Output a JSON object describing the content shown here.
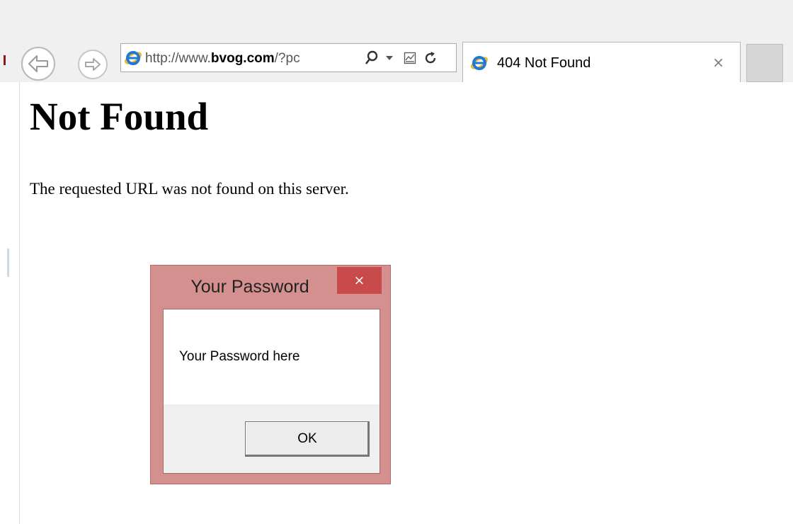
{
  "browser": {
    "address": {
      "url_prefix": "http://www.",
      "url_domain": "bvog.com",
      "url_suffix": "/?pc"
    },
    "tab": {
      "title": "404 Not Found",
      "close_glyph": "×"
    },
    "icons": {
      "back": "back-arrow-icon",
      "forward": "forward-arrow-icon",
      "ie_logo": "internet-explorer-icon",
      "search": "search-icon",
      "dropdown": "dropdown-arrow-icon",
      "compat": "compatibility-view-icon",
      "refresh": "refresh-icon"
    }
  },
  "page": {
    "heading": "Not Found",
    "message": "The requested URL was not found on this server."
  },
  "dialog": {
    "title": "Your Password",
    "close_glyph": "×",
    "message": "Your Password here",
    "ok_label": "OK"
  },
  "colors": {
    "dialog_frame": "#d4908e",
    "dialog_close": "#c94a4a",
    "ie_blue": "#1f7ad6",
    "ie_ring": "#f2b321"
  }
}
